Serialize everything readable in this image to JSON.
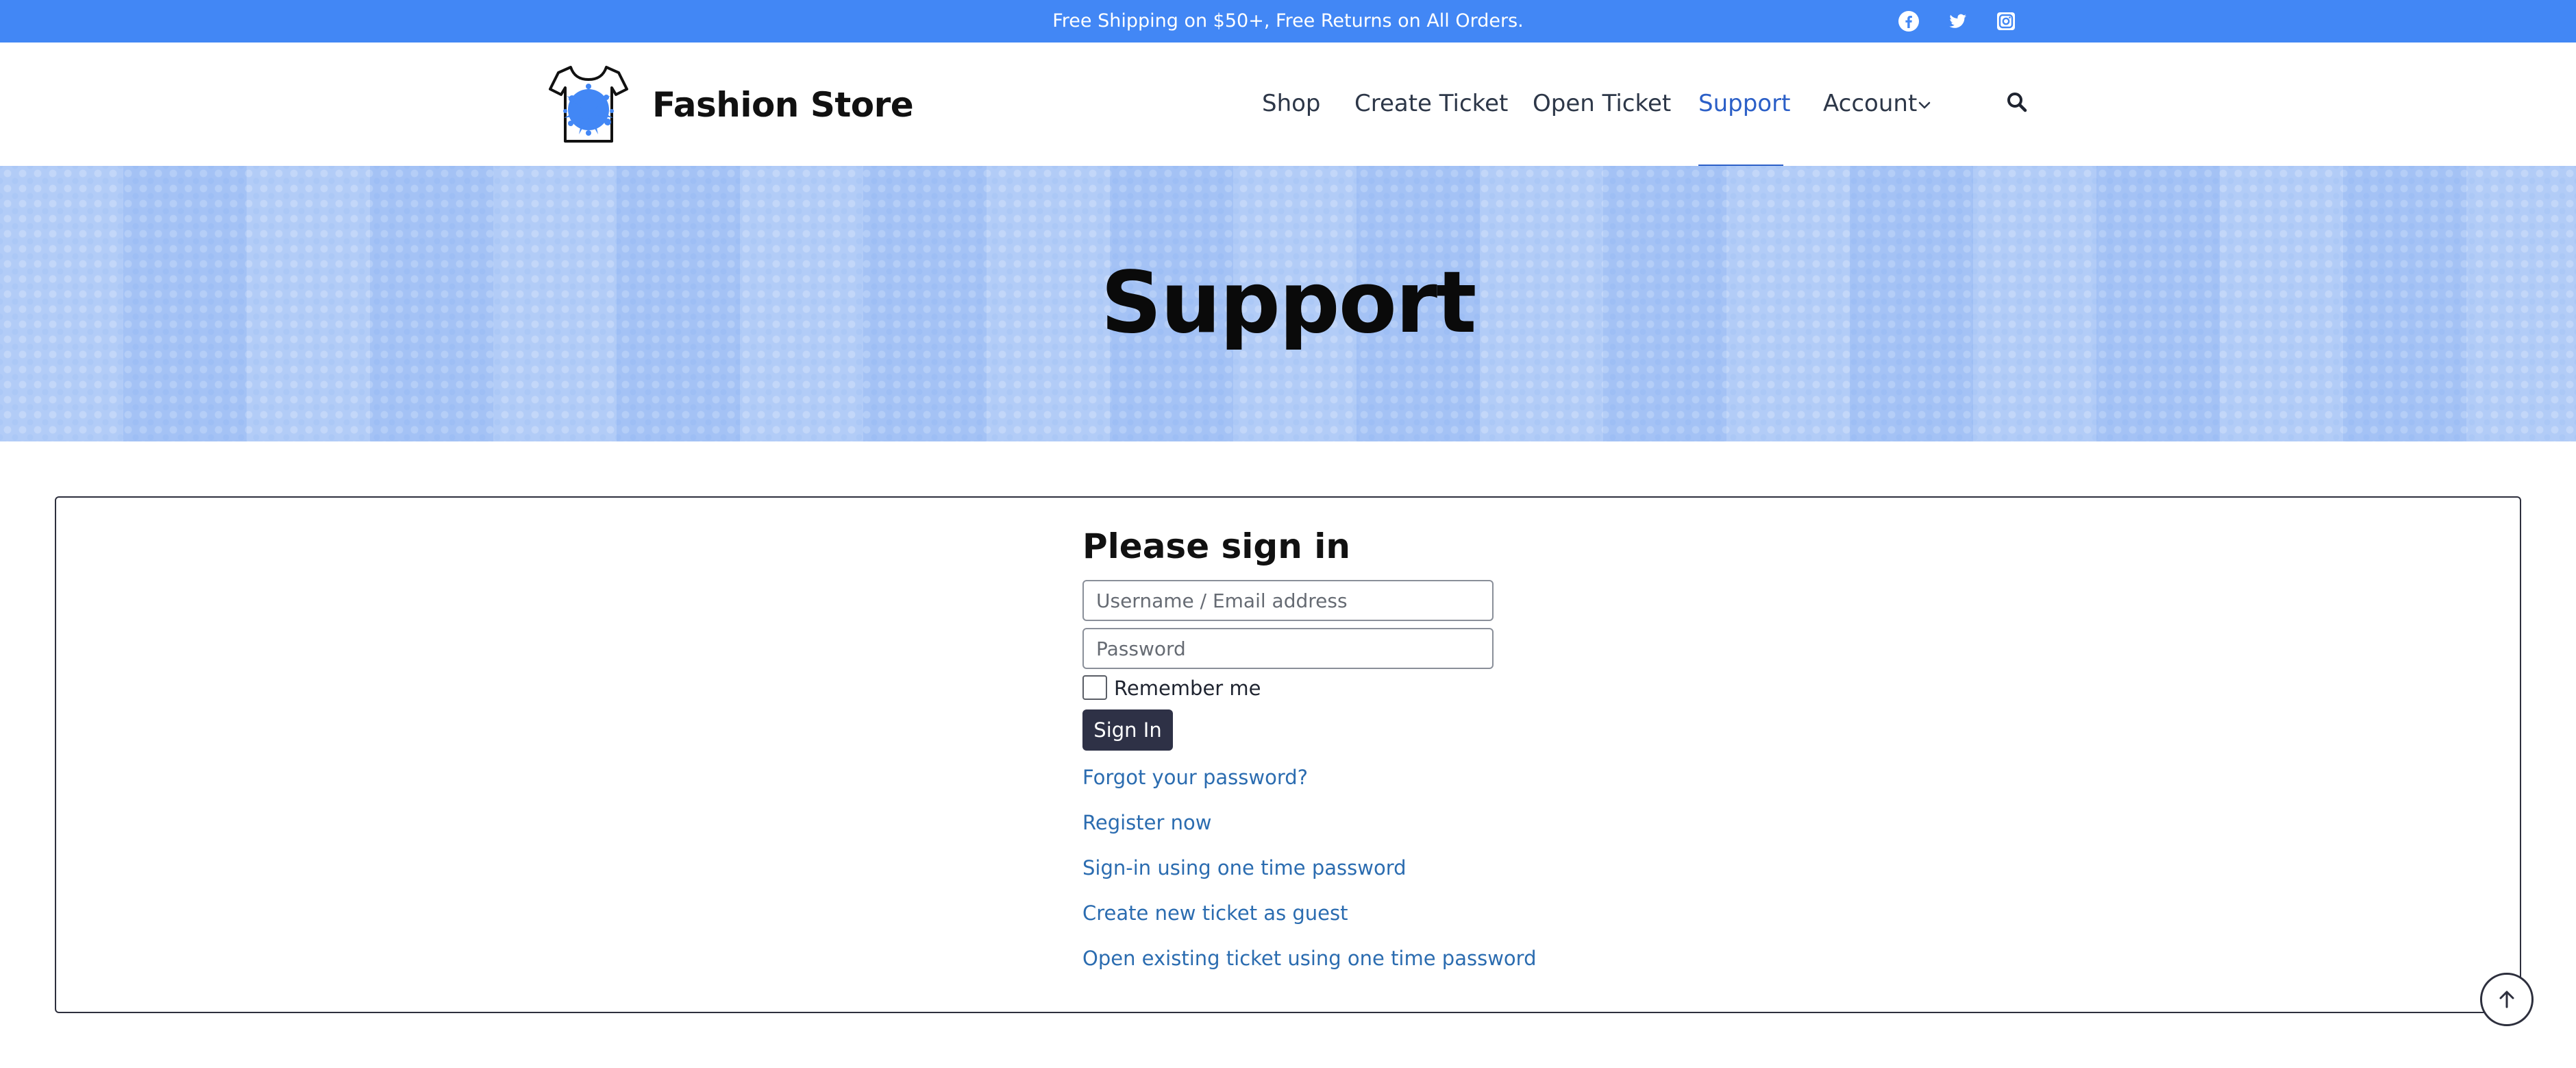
{
  "topbar": {
    "announcement": "Free Shipping on $50+, Free Returns on All Orders.",
    "social_icons": [
      "facebook-icon",
      "twitter-icon",
      "instagram-icon"
    ],
    "background_color": "#4287f5"
  },
  "header": {
    "brand": "Fashion Store",
    "logo_icon": "tshirt-logo-icon",
    "nav": {
      "shop": "Shop",
      "create_ticket": "Create Ticket",
      "open_ticket": "Open Ticket",
      "support": "Support",
      "account": "Account"
    },
    "active_nav": "Support",
    "accent_color": "#2b5fc7",
    "search_icon": "search-icon"
  },
  "hero": {
    "title": "Support",
    "background_color": "#a9c6f6"
  },
  "signin": {
    "heading": "Please sign in",
    "username_placeholder": "Username / Email address",
    "username_value": "",
    "password_placeholder": "Password",
    "password_value": "",
    "remember_label": "Remember me",
    "remember_checked": false,
    "submit_label": "Sign In",
    "button_color": "#2e3146",
    "links": {
      "forgot": "Forgot your password?",
      "register": "Register now",
      "otp_signin": "Sign-in using one time password",
      "guest_ticket": "Create new ticket as guest",
      "open_existing": "Open existing ticket using one time password"
    },
    "link_color": "#2b6cb0"
  },
  "scroll_top_icon": "arrow-up-icon"
}
